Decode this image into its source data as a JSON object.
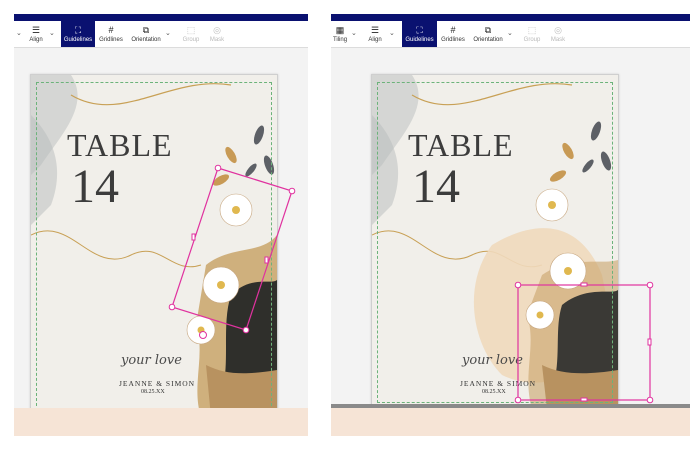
{
  "colors": {
    "topbar": "#0a1170",
    "active_tool": "#0a1170",
    "selection": "#e0329f",
    "guideline": "#6cb37a",
    "peach_strip": "#f6e4d6"
  },
  "left_panel": {
    "toolbar": {
      "tiling_label": "",
      "align_label": "Align",
      "guidelines_label": "Guidelines",
      "gridlines_label": "Gridlines",
      "orientation_label": "Orientation",
      "group_label": "Group",
      "mask_label": "Mask"
    },
    "card": {
      "title": "TABLE",
      "number": "14",
      "script": "your love",
      "names": "JEANNE & SIMON",
      "date": "08.25.XX"
    }
  },
  "right_panel": {
    "toolbar": {
      "tiling_label": "Tiling",
      "align_label": "Align",
      "guidelines_label": "Guidelines",
      "gridlines_label": "Gridlines",
      "orientation_label": "Orientation",
      "group_label": "Group",
      "mask_label": "Mask"
    },
    "card": {
      "title": "TABLE",
      "number": "14",
      "script": "your love",
      "names": "JEANNE & SIMON",
      "date": "08.25.XX"
    }
  },
  "icons": {
    "tiling": "tiling-icon",
    "align": "align-icon",
    "guidelines": "guidelines-icon",
    "gridlines": "gridlines-icon",
    "orientation": "orientation-icon",
    "group": "group-icon",
    "mask": "mask-icon"
  }
}
